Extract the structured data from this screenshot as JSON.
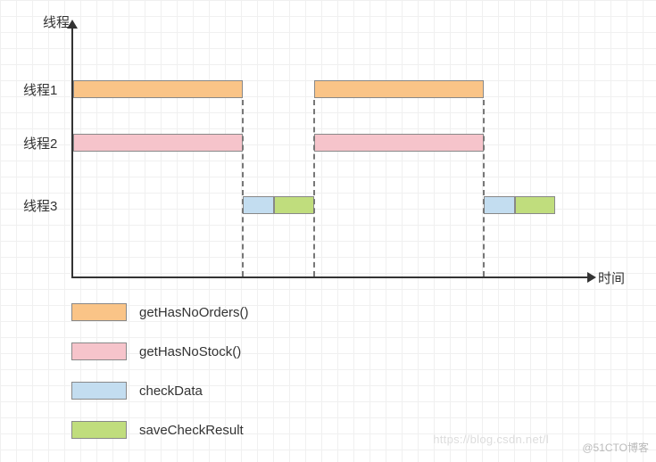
{
  "axes": {
    "y_label": "线程",
    "x_label": "时间"
  },
  "rows": {
    "row1_label": "线程1",
    "row2_label": "线程2",
    "row3_label": "线程3"
  },
  "legend": {
    "items": [
      {
        "label": "getHasNoOrders()"
      },
      {
        "label": "getHasNoStock()"
      },
      {
        "label": "checkData"
      },
      {
        "label": "saveCheckResult"
      }
    ]
  },
  "watermark": {
    "main": "@51CTO博客",
    "faded": "https://blog.csdn.net/l"
  },
  "chart_data": {
    "type": "bar",
    "categories": [
      "线程1",
      "线程2",
      "线程3"
    ],
    "series_colors": {
      "getHasNoOrders()": "#fac487",
      "getHasNoStock()": "#f6c4cb",
      "checkData": "#c3ddf0",
      "saveCheckResult": "#c0dd7d"
    },
    "bars": [
      {
        "thread": "线程1",
        "task": "getHasNoOrders()",
        "x0": 0,
        "x1": 190
      },
      {
        "thread": "线程2",
        "task": "getHasNoStock()",
        "x0": 0,
        "x1": 190
      },
      {
        "thread": "线程3",
        "task": "checkData",
        "x0": 190,
        "x1": 225
      },
      {
        "thread": "线程3",
        "task": "saveCheckResult",
        "x0": 225,
        "x1": 270
      },
      {
        "thread": "线程1",
        "task": "getHasNoOrders()",
        "x0": 270,
        "x1": 460
      },
      {
        "thread": "线程2",
        "task": "getHasNoStock()",
        "x0": 270,
        "x1": 460
      },
      {
        "thread": "线程3",
        "task": "checkData",
        "x0": 460,
        "x1": 495
      },
      {
        "thread": "线程3",
        "task": "saveCheckResult",
        "x0": 495,
        "x1": 540
      }
    ],
    "row_y": {
      "线程1": 90,
      "线程2": 150,
      "线程3": 220
    },
    "dashed_guides_x": [
      190,
      270,
      460
    ],
    "xlim": [
      0,
      580
    ],
    "title": "",
    "xlabel": "时间",
    "ylabel": "线程"
  }
}
